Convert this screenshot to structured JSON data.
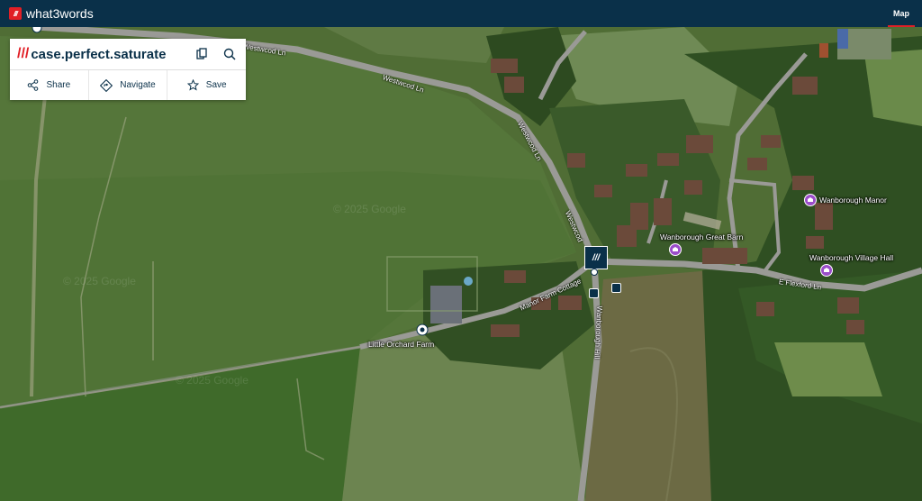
{
  "header": {
    "logo_mark": "///",
    "brand": "what3words",
    "nav_map": "Map"
  },
  "card": {
    "slashes": "///",
    "address": "case.perfect.saturate",
    "actions": [
      {
        "label": "Share",
        "icon": "share-icon"
      },
      {
        "label": "Navigate",
        "icon": "navigate-icon"
      },
      {
        "label": "Save",
        "icon": "star-icon"
      }
    ]
  },
  "map": {
    "roads": {
      "westwood_1": "Westwcod Ln",
      "westwood_2": "Westwcod Ln",
      "westwood_3": "Westwcod Ln",
      "westwood_4": "Westwcod",
      "manor_farm": "Manor Farm Cottage",
      "wanborough_hill": "Wanborough Hill",
      "e_flexford": "E Flexford Ln"
    },
    "pois": {
      "little_orchard": "Little Orchard Farm",
      "great_barn": "Wanborough Great Barn",
      "manor": "Wanborough Manor",
      "village_hall": "Wanborough Village Hall"
    },
    "square_label": "///",
    "watermark": "© 2025 Google"
  },
  "colors": {
    "brand_navy": "#0a3049",
    "brand_red": "#e11f26",
    "poi_purple": "#9b4dca"
  }
}
